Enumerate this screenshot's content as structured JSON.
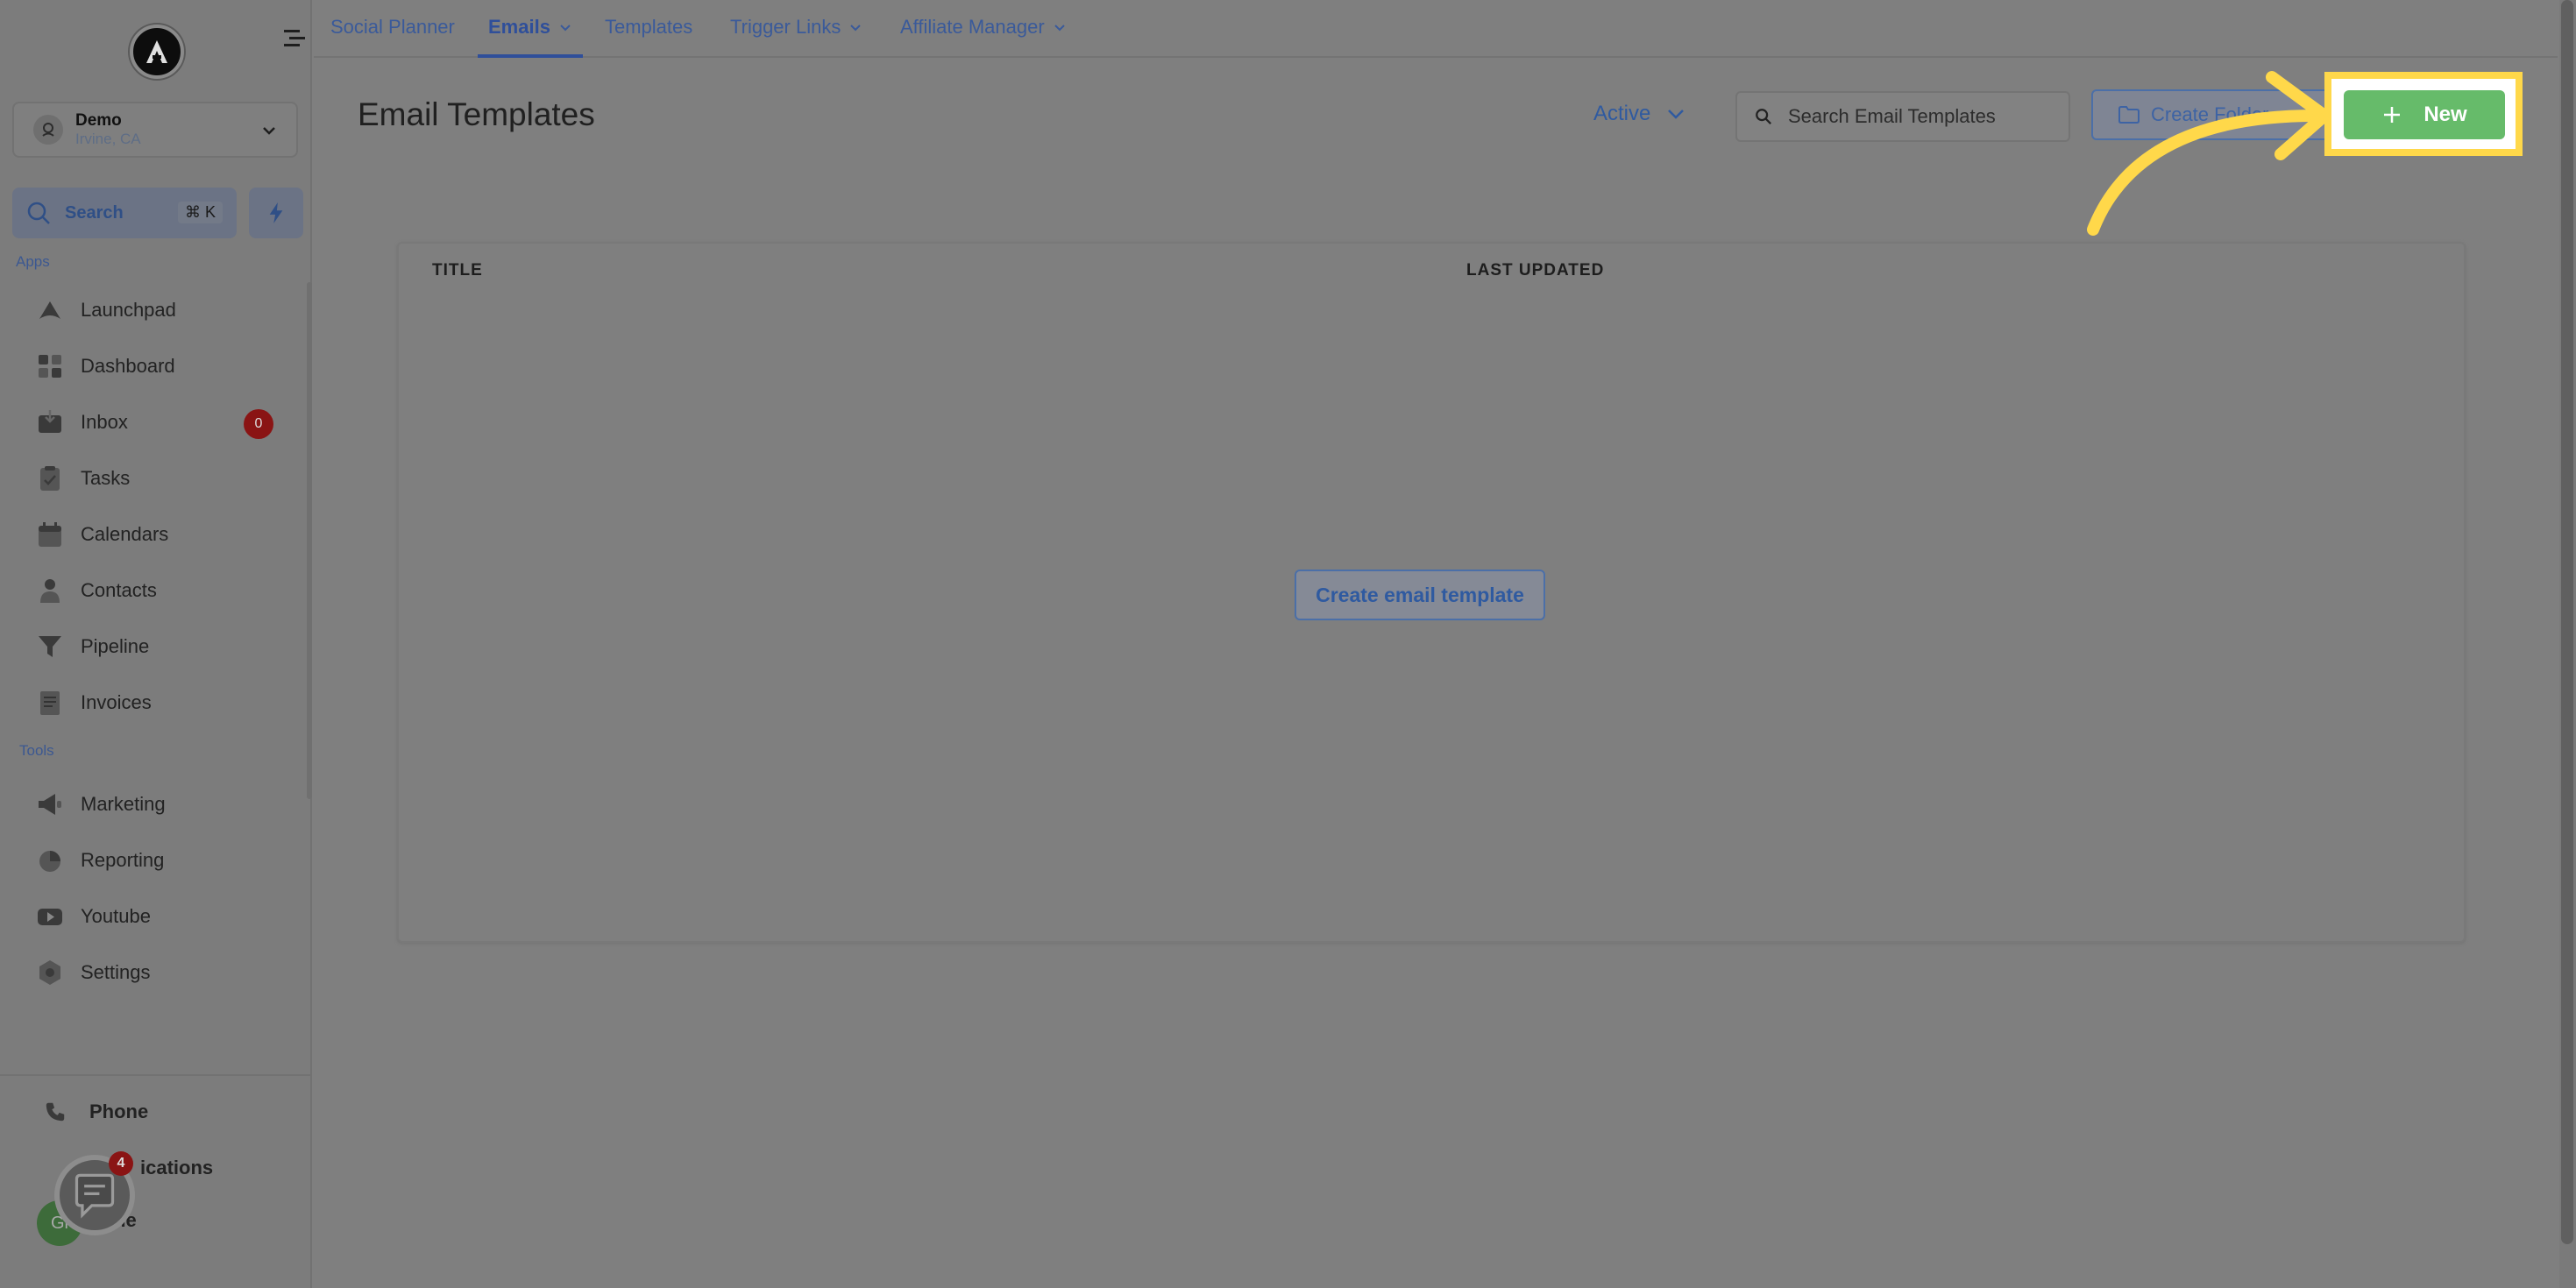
{
  "sidebar": {
    "account": {
      "name": "Demo",
      "location": "Irvine, CA"
    },
    "search": {
      "label": "Search",
      "shortcut": "⌘ K"
    },
    "apps_label": "Apps",
    "tools_label": "Tools",
    "apps": [
      {
        "label": "Launchpad",
        "icon": "rocket-icon"
      },
      {
        "label": "Dashboard",
        "icon": "grid-icon"
      },
      {
        "label": "Inbox",
        "icon": "inbox-icon",
        "badge": "0"
      },
      {
        "label": "Tasks",
        "icon": "clipboard-icon"
      },
      {
        "label": "Calendars",
        "icon": "calendar-icon"
      },
      {
        "label": "Contacts",
        "icon": "person-icon"
      },
      {
        "label": "Pipeline",
        "icon": "funnel-icon"
      },
      {
        "label": "Invoices",
        "icon": "invoice-icon"
      }
    ],
    "tools": [
      {
        "label": "Marketing",
        "icon": "megaphone-icon"
      },
      {
        "label": "Reporting",
        "icon": "pie-chart-icon"
      },
      {
        "label": "Youtube",
        "icon": "youtube-icon"
      },
      {
        "label": "Settings",
        "icon": "gear-icon"
      }
    ],
    "bottom": {
      "phone": "Phone",
      "notifications": "ications",
      "profile": "file",
      "avatar_initials": "Gl",
      "chat_badge": "4"
    }
  },
  "topnav": {
    "tabs": [
      {
        "label": "Social Planner",
        "dropdown": false
      },
      {
        "label": "Emails",
        "dropdown": true,
        "active": true
      },
      {
        "label": "Templates",
        "dropdown": false
      },
      {
        "label": "Trigger Links",
        "dropdown": true
      },
      {
        "label": "Affiliate Manager",
        "dropdown": true
      }
    ]
  },
  "header": {
    "title": "Email Templates",
    "status_filter": "Active",
    "search_placeholder": "Search Email Templates",
    "create_folder_label": "Create Folder",
    "new_label": "New"
  },
  "table": {
    "columns": [
      "TITLE",
      "LAST UPDATED"
    ],
    "empty_action": "Create email template"
  },
  "colors": {
    "accent": "#2f5aa0",
    "new_button": "#66bb6a",
    "highlight": "#ffd84a",
    "badge": "#8a1414"
  }
}
